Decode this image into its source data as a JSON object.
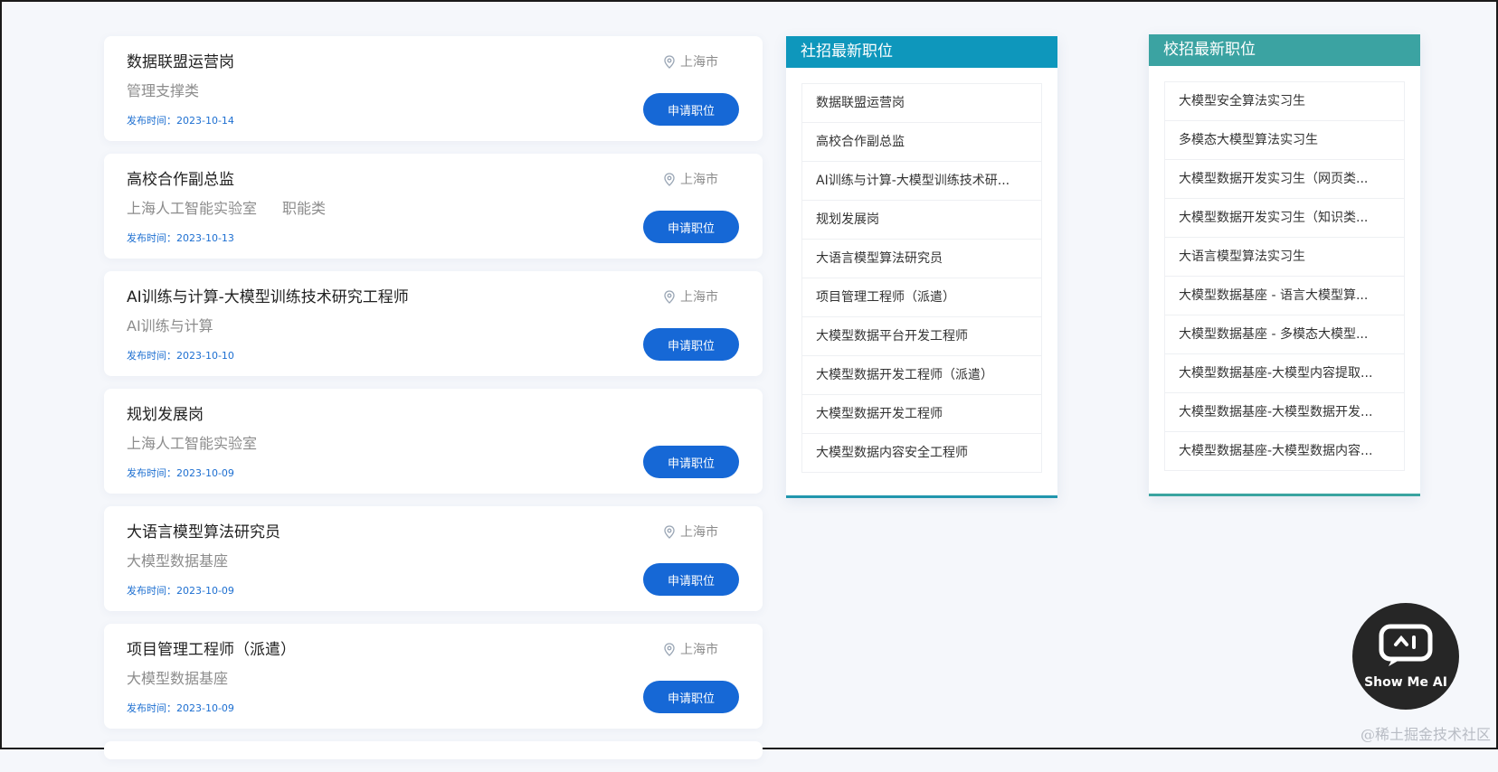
{
  "job_list": {
    "apply_label": "申请职位",
    "date_prefix": "发布时间：",
    "items": [
      {
        "title": "数据联盟运营岗",
        "subs": [
          "管理支撑类"
        ],
        "location": "上海市",
        "date": "2023-10-14"
      },
      {
        "title": "高校合作副总监",
        "subs": [
          "上海人工智能实验室",
          "职能类"
        ],
        "location": "上海市",
        "date": "2023-10-13"
      },
      {
        "title": "AI训练与计算-大模型训练技术研究工程师",
        "subs": [
          "AI训练与计算"
        ],
        "location": "上海市",
        "date": "2023-10-10"
      },
      {
        "title": "规划发展岗",
        "subs": [
          "上海人工智能实验室"
        ],
        "location": "",
        "date": "2023-10-09"
      },
      {
        "title": "大语言模型算法研究员",
        "subs": [
          "大模型数据基座"
        ],
        "location": "上海市",
        "date": "2023-10-09"
      },
      {
        "title": "项目管理工程师（派遣）",
        "subs": [
          "大模型数据基座"
        ],
        "location": "上海市",
        "date": "2023-10-09"
      }
    ]
  },
  "social_panel": {
    "title": "社招最新职位",
    "items": [
      "数据联盟运营岗",
      "高校合作副总监",
      "AI训练与计算-大模型训练技术研...",
      "规划发展岗",
      "大语言模型算法研究员",
      "项目管理工程师（派遣）",
      "大模型数据平台开发工程师",
      "大模型数据开发工程师（派遣）",
      "大模型数据开发工程师",
      "大模型数据内容安全工程师"
    ]
  },
  "campus_panel": {
    "title": "校招最新职位",
    "items": [
      "大模型安全算法实习生",
      "多模态大模型算法实习生",
      "大模型数据开发实习生（网页类...",
      "大模型数据开发实习生（知识类...",
      "大语言模型算法实习生",
      "大模型数据基座 - 语言大模型算...",
      "大模型数据基座 - 多模态大模型...",
      "大模型数据基座-大模型内容提取...",
      "大模型数据基座-大模型数据开发...",
      "大模型数据基座-大模型数据内容..."
    ]
  },
  "logo": {
    "text": "Show Me AI"
  },
  "watermark": "@稀土掘金技术社区",
  "colors": {
    "primary_button": "#1668d6",
    "social_header": "#0e97bc",
    "campus_header": "#3ba3a2"
  }
}
